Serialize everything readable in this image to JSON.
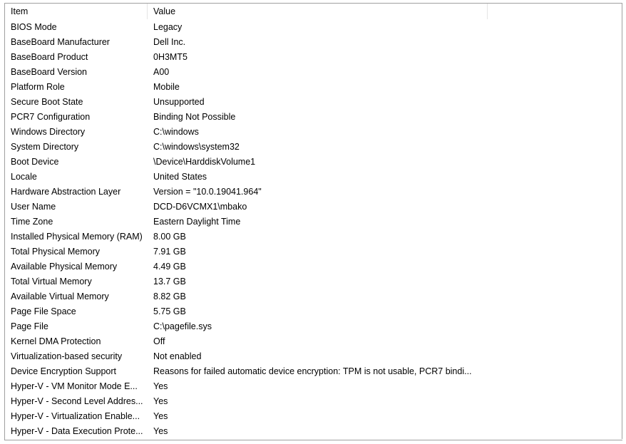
{
  "columns": {
    "item": "Item",
    "value": "Value"
  },
  "rows": [
    {
      "item": "BIOS Mode",
      "value": "Legacy"
    },
    {
      "item": "BaseBoard Manufacturer",
      "value": "Dell Inc."
    },
    {
      "item": "BaseBoard Product",
      "value": "0H3MT5"
    },
    {
      "item": "BaseBoard Version",
      "value": "A00"
    },
    {
      "item": "Platform Role",
      "value": "Mobile"
    },
    {
      "item": "Secure Boot State",
      "value": "Unsupported"
    },
    {
      "item": "PCR7 Configuration",
      "value": "Binding Not Possible"
    },
    {
      "item": "Windows Directory",
      "value": "C:\\windows"
    },
    {
      "item": "System Directory",
      "value": "C:\\windows\\system32"
    },
    {
      "item": "Boot Device",
      "value": "\\Device\\HarddiskVolume1"
    },
    {
      "item": "Locale",
      "value": "United States"
    },
    {
      "item": "Hardware Abstraction Layer",
      "value": "Version = \"10.0.19041.964\""
    },
    {
      "item": "User Name",
      "value": "DCD-D6VCMX1\\mbako"
    },
    {
      "item": "Time Zone",
      "value": "Eastern Daylight Time"
    },
    {
      "item": "Installed Physical Memory (RAM)",
      "value": "8.00 GB"
    },
    {
      "item": "Total Physical Memory",
      "value": "7.91 GB"
    },
    {
      "item": "Available Physical Memory",
      "value": "4.49 GB"
    },
    {
      "item": "Total Virtual Memory",
      "value": "13.7 GB"
    },
    {
      "item": "Available Virtual Memory",
      "value": "8.82 GB"
    },
    {
      "item": "Page File Space",
      "value": "5.75 GB"
    },
    {
      "item": "Page File",
      "value": "C:\\pagefile.sys"
    },
    {
      "item": "Kernel DMA Protection",
      "value": "Off"
    },
    {
      "item": "Virtualization-based security",
      "value": "Not enabled"
    },
    {
      "item": "Device Encryption Support",
      "value": "Reasons for failed automatic device encryption: TPM is not usable, PCR7 bindi..."
    },
    {
      "item": "Hyper-V - VM Monitor Mode E...",
      "value": "Yes"
    },
    {
      "item": "Hyper-V - Second Level Addres...",
      "value": "Yes"
    },
    {
      "item": "Hyper-V - Virtualization Enable...",
      "value": "Yes"
    },
    {
      "item": "Hyper-V - Data Execution Prote...",
      "value": "Yes"
    }
  ]
}
